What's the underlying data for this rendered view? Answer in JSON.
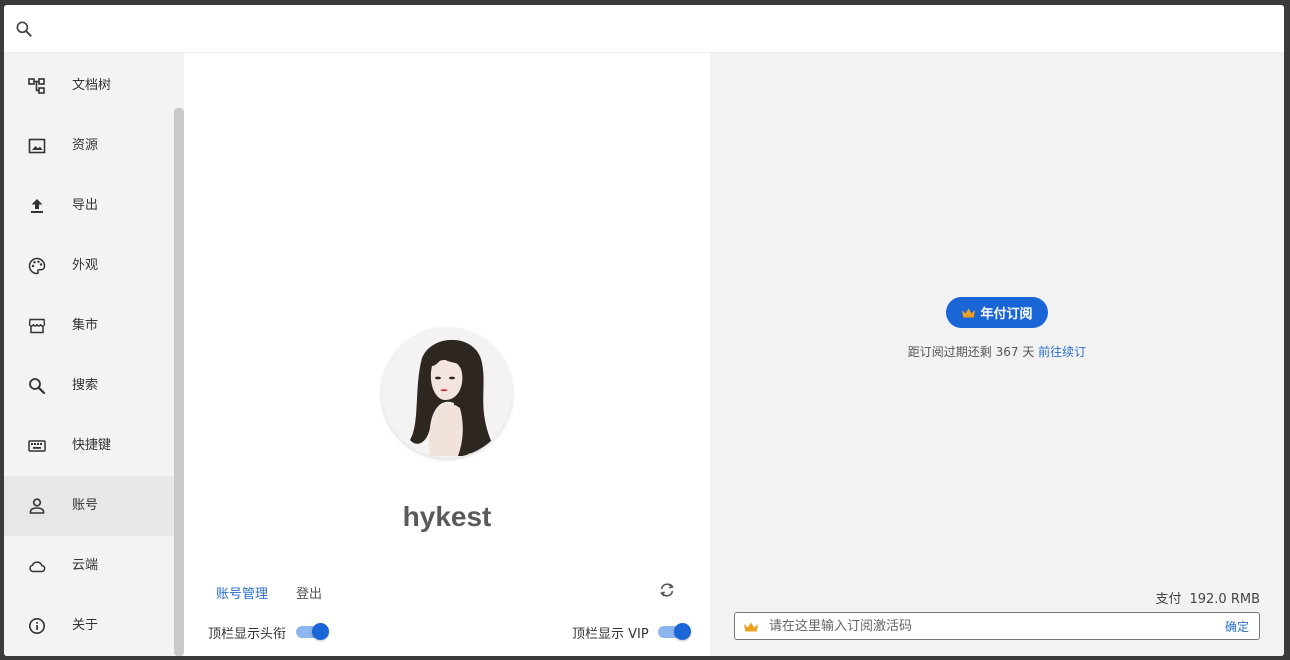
{
  "search": {
    "placeholder": "",
    "value": ""
  },
  "sidebar": {
    "items": [
      {
        "label": "文档树",
        "icon": "tree-icon"
      },
      {
        "label": "资源",
        "icon": "image-icon"
      },
      {
        "label": "导出",
        "icon": "upload-icon"
      },
      {
        "label": "外观",
        "icon": "palette-icon"
      },
      {
        "label": "集市",
        "icon": "store-icon"
      },
      {
        "label": "搜索",
        "icon": "search-icon"
      },
      {
        "label": "快捷键",
        "icon": "keyboard-icon"
      },
      {
        "label": "账号",
        "icon": "account-icon",
        "active": true
      },
      {
        "label": "云端",
        "icon": "cloud-icon"
      },
      {
        "label": "关于",
        "icon": "info-icon"
      }
    ]
  },
  "account": {
    "username": "hykest",
    "manage_label": "账号管理",
    "logout_label": "登出",
    "toggle_title_label": "顶栏显示头衔",
    "toggle_title_on": true,
    "toggle_vip_label": "顶栏显示 VIP",
    "toggle_vip_on": true
  },
  "subscription": {
    "button_label": "年付订阅",
    "remain_prefix": "距订阅过期还剩 367 天",
    "renew_label": "前往续订",
    "pay_label": "支付",
    "pay_amount": "192.0 RMB",
    "code_placeholder": "请在这里输入订阅激活码",
    "confirm_label": "确定"
  },
  "colors": {
    "accent": "#1a66d6",
    "link": "#2a6fc9",
    "crown": "#f0a020",
    "sidebar_bg": "#f3f3f3",
    "active_bg": "#e6e7e8",
    "right_bg": "#f2f2f2"
  }
}
